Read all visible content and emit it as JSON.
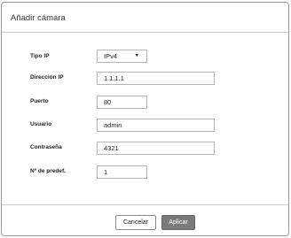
{
  "dialog": {
    "title": "Añadir cámara"
  },
  "form": {
    "ip_type": {
      "label": "Tipo IP",
      "value": "IPv4",
      "caret": "▼"
    },
    "ip_address": {
      "label": "Dirección IP",
      "value": "1.1.1.1"
    },
    "port": {
      "label": "Puerto",
      "value": "80"
    },
    "user": {
      "label": "Usuario",
      "value": "admin"
    },
    "password": {
      "label": "Contraseña",
      "value": "4321"
    },
    "preset": {
      "label": "Nº de predef.",
      "value": "1"
    }
  },
  "buttons": {
    "cancel": "Cancelar",
    "apply": "Aplicar"
  }
}
